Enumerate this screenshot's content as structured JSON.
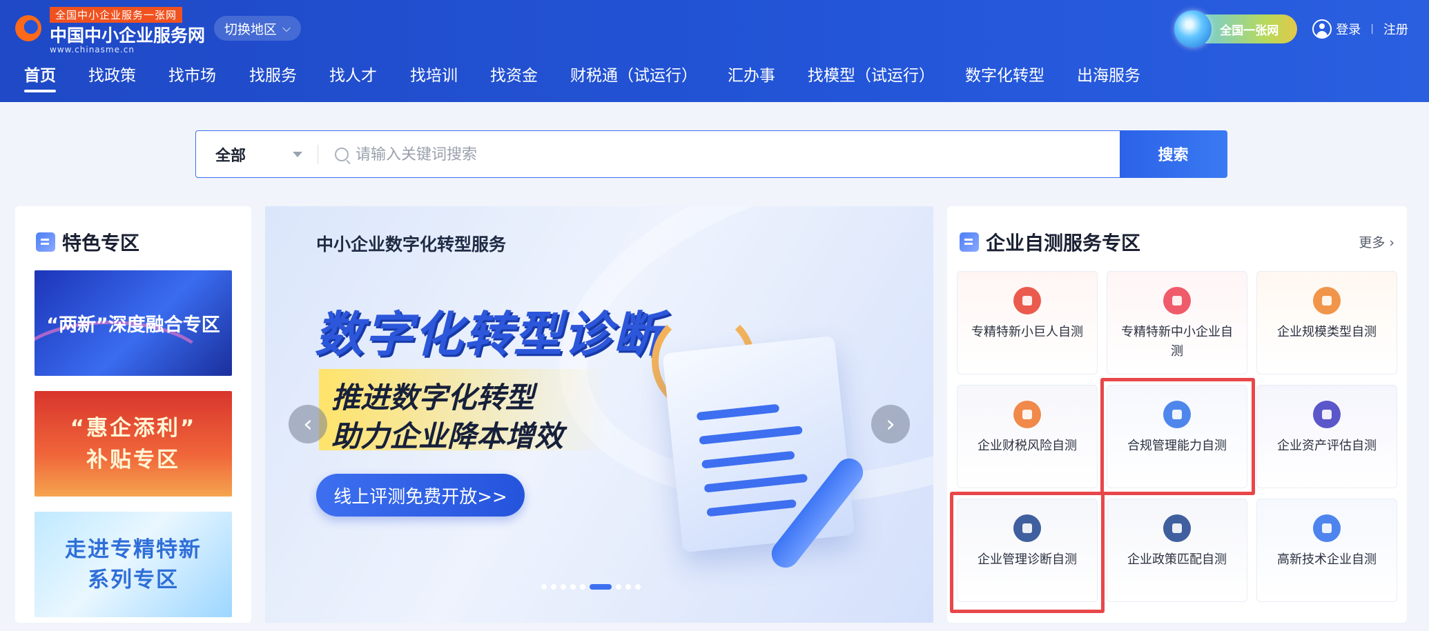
{
  "header": {
    "logo": {
      "tag": "全国中小企业服务一张网",
      "name": "中国中小企业服务网",
      "url": "www.chinasme.cn"
    },
    "region_button": "切换地区",
    "badge": "全国一张网",
    "login": "登录",
    "separator": "|",
    "register": "注册"
  },
  "nav": {
    "items": [
      {
        "label": "首页",
        "active": true
      },
      {
        "label": "找政策"
      },
      {
        "label": "找市场"
      },
      {
        "label": "找服务"
      },
      {
        "label": "找人才"
      },
      {
        "label": "找培训"
      },
      {
        "label": "找资金"
      },
      {
        "label": "财税通（试运行）"
      },
      {
        "label": "汇办事"
      },
      {
        "label": "找模型（试运行）"
      },
      {
        "label": "数字化转型"
      },
      {
        "label": "出海服务"
      }
    ]
  },
  "search": {
    "scope": "全部",
    "placeholder": "请输入关键词搜索",
    "button": "搜索"
  },
  "featured": {
    "title": "特色专区",
    "banners": [
      {
        "text": "“两新”深度融合专区"
      },
      {
        "line1": "“惠企添利”",
        "line2": "补贴专区"
      },
      {
        "line1": "走进专精特新",
        "line2": "系列专区"
      }
    ]
  },
  "banner": {
    "subtitle": "中小企业数字化转型服务",
    "title": "数字化转型诊断",
    "slogan_1": "推进数字化转型",
    "slogan_2": "助力企业降本增效",
    "cta": "线上评测免费开放>>",
    "prev_arrow": "‹",
    "next_arrow": "›",
    "active_slide": 6,
    "slide_count": 9
  },
  "self_test": {
    "title": "企业自测服务专区",
    "more": "更多",
    "more_chevron": "›",
    "items": [
      {
        "label": "专精特新小巨人自测",
        "icon": "giant-icon",
        "color": "#ea5b4e",
        "bg": "#fff6f4"
      },
      {
        "label": "专精特新中小企业自测",
        "icon": "sme-icon",
        "color": "#ef5b6a",
        "bg": "#fff5f6"
      },
      {
        "label": "企业规模类型自测",
        "icon": "scale-icon",
        "color": "#f0954a",
        "bg": "#fff8f1"
      },
      {
        "label": "企业财税风险自测",
        "icon": "tax-icon",
        "color": "#f0894a",
        "bg": "#f7f7fc"
      },
      {
        "label": "合规管理能力自测",
        "icon": "compliance-icon",
        "color": "#4f86ec",
        "bg": "#f6f8fe",
        "highlighted": true
      },
      {
        "label": "企业资产评估自测",
        "icon": "asset-icon",
        "color": "#5b56c9",
        "bg": "#f5f5fd"
      },
      {
        "label": "企业管理诊断自测",
        "icon": "management-icon",
        "color": "#3f5f9e",
        "bg": "#f6f7fb",
        "highlighted": true
      },
      {
        "label": "企业政策匹配自测",
        "icon": "policy-icon",
        "color": "#3f5f9e",
        "bg": "#f6f7fb"
      },
      {
        "label": "高新技术企业自测",
        "icon": "hightech-icon",
        "color": "#4d84ee",
        "bg": "#f5f8fe"
      }
    ]
  }
}
